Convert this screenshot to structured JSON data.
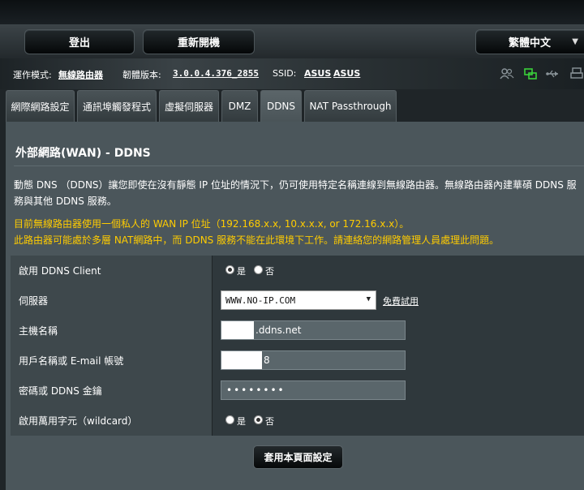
{
  "header": {
    "logout_label": "登出",
    "reboot_label": "重新開機",
    "language_label": "繁體中文"
  },
  "status": {
    "mode_label": "運作模式:",
    "mode_value": "無線路由器",
    "firmware_label": "韌體版本:",
    "firmware_value": "3.0.0.4.376_2855",
    "ssid_label": "SSID:",
    "ssid_values": [
      "ASUS",
      "ASUS"
    ],
    "icons": [
      "clients-icon",
      "network-status-icon",
      "usb-icon",
      "printer-icon"
    ]
  },
  "tabs": [
    {
      "label": "網際網路設定",
      "active": false
    },
    {
      "label": "通訊埠觸發程式",
      "active": false
    },
    {
      "label": "虛擬伺服器",
      "active": false
    },
    {
      "label": "DMZ",
      "active": false
    },
    {
      "label": "DDNS",
      "active": true
    },
    {
      "label": "NAT Passthrough",
      "active": false
    }
  ],
  "content": {
    "title": "外部網路(WAN) - DDNS",
    "description": "動態 DNS （DDNS）讓您即使在沒有靜態 IP 位址的情況下，仍可使用特定名稱連線到無線路由器。無線路由器內建華碩 DDNS 服務與其他 DDNS 服務。",
    "warning_line1": "目前無線路由器使用一個私人的 WAN IP 位址（192.168.x.x, 10.x.x.x, or 172.16.x.x）。",
    "warning_line2": "此路由器可能處於多層 NAT網路中，而 DDNS 服務不能在此環境下工作。請連絡您的網路管理人員處理此問題。"
  },
  "form": {
    "enable_ddns": {
      "label": "啟用 DDNS Client",
      "yes": "是",
      "no": "否",
      "selected": "yes"
    },
    "server": {
      "label": "伺服器",
      "value": "WWW.NO-IP.COM",
      "link": "免費試用"
    },
    "hostname": {
      "label": "主機名稱",
      "value": ".ddns.net"
    },
    "username": {
      "label": "用戶名稱或 E-mail 帳號",
      "value": "8"
    },
    "password": {
      "label": "密碼或 DDNS 金鑰",
      "value": "••••••••"
    },
    "wildcard": {
      "label": "啟用萬用字元（wildcard）",
      "yes": "是",
      "no": "否",
      "selected": "no"
    }
  },
  "apply_label": "套用本頁面設定",
  "colors": {
    "warning": "#ffcc00",
    "content_bg": "#4b565b",
    "label_bg": "#3e484c",
    "value_bg": "#2f383c",
    "status_green": "#3ad13a"
  }
}
